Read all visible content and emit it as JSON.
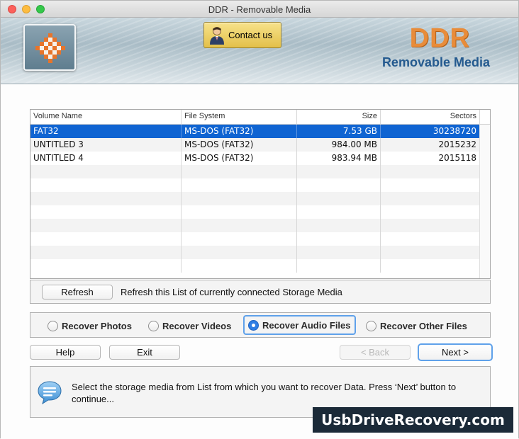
{
  "window": {
    "title": "DDR - Removable Media"
  },
  "header": {
    "contact_label": "Contact us",
    "brand_title": "DDR",
    "brand_subtitle": "Removable Media",
    "brand_color": "#e88c3a",
    "subtitle_color": "#245a8f"
  },
  "table": {
    "columns": [
      "Volume Name",
      "File System",
      "Size",
      "Sectors"
    ],
    "rows": [
      {
        "name": "FAT32",
        "fs": "MS-DOS (FAT32)",
        "size": "7.53  GB",
        "sectors": "30238720",
        "selected": true
      },
      {
        "name": "UNTITLED 3",
        "fs": "MS-DOS (FAT32)",
        "size": "984.00  MB",
        "sectors": "2015232",
        "selected": false
      },
      {
        "name": "UNTITLED 4",
        "fs": "MS-DOS (FAT32)",
        "size": "983.94  MB",
        "sectors": "2015118",
        "selected": false
      }
    ],
    "selection_color": "#0f64d2"
  },
  "refresh": {
    "button_label": "Refresh",
    "description": "Refresh this List of currently connected Storage Media"
  },
  "options": {
    "items": [
      {
        "label": "Recover Photos",
        "selected": false
      },
      {
        "label": "Recover Videos",
        "selected": false
      },
      {
        "label": "Recover Audio Files",
        "selected": true
      },
      {
        "label": "Recover Other Files",
        "selected": false
      }
    ]
  },
  "buttons": {
    "help": "Help",
    "exit": "Exit",
    "back": "< Back",
    "next": "Next >"
  },
  "info": {
    "icon": "speech-bubble-icon",
    "message": "Select the storage media from List from which you want to recover Data. Press ‘Next’ button to continue..."
  },
  "watermark": {
    "text": "UsbDriveRecovery.com"
  }
}
